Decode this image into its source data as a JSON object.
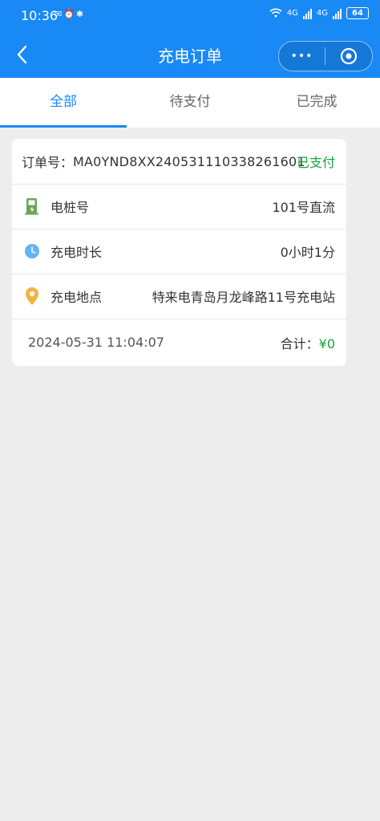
{
  "status": {
    "time": "10:36",
    "net1": "4G",
    "net2": "4G",
    "battery": "64"
  },
  "nav": {
    "title": "充电订单",
    "more_label": "•••"
  },
  "tabs": [
    {
      "label": "全部"
    },
    {
      "label": "待支付"
    },
    {
      "label": "已完成"
    }
  ],
  "order": {
    "order_no_label": "订单号：",
    "order_no": "MA0YND8XX240531110338261601",
    "status": "已支付",
    "fields": [
      {
        "label": "电桩号",
        "value": "101号直流",
        "icon": "charging-pile-icon"
      },
      {
        "label": "充电时长",
        "value": "0小时1分",
        "icon": "clock-icon"
      },
      {
        "label": "充电地点",
        "value": "特来电青岛月龙峰路11号充电站",
        "icon": "location-pin-icon"
      }
    ],
    "datetime": "2024-05-31 11:04:07",
    "total_label": "合计：",
    "total_value": "¥0"
  },
  "colors": {
    "primary": "#1989f5",
    "paid": "#1aa23c",
    "background": "#ededed"
  }
}
